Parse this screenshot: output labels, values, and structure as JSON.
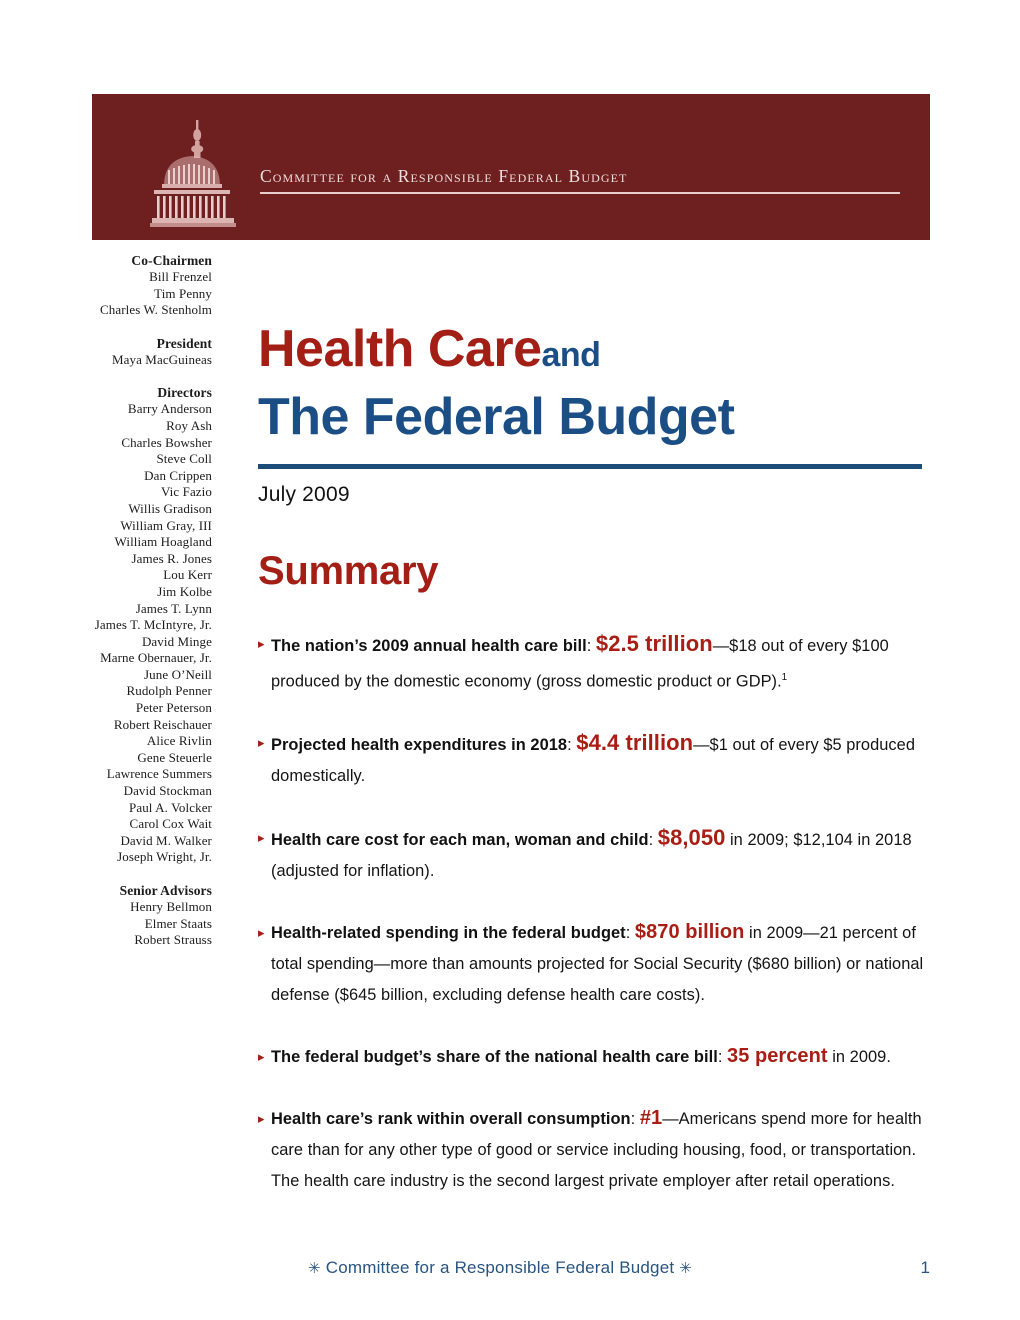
{
  "banner": {
    "logo_icon": "capitol-dome-icon",
    "organization": "Committee for a Responsible Federal Budget",
    "background_color": "#6E2020"
  },
  "sidebar": {
    "groups": [
      {
        "heading": "Co-Chairmen",
        "names": [
          "Bill Frenzel",
          "Tim Penny",
          "Charles W. Stenholm"
        ]
      },
      {
        "heading": "President",
        "names": [
          "Maya MacGuineas"
        ]
      },
      {
        "heading": "Directors",
        "names": [
          "Barry Anderson",
          "Roy Ash",
          "Charles Bowsher",
          "Steve Coll",
          "Dan Crippen",
          "Vic Fazio",
          "Willis Gradison",
          "William Gray, III",
          "William Hoagland",
          "James R. Jones",
          "Lou Kerr",
          "Jim Kolbe",
          "James T. Lynn",
          "James T. McIntyre, Jr.",
          "David Minge",
          "Marne Obernauer, Jr.",
          "June O’Neill",
          "Rudolph Penner",
          "Peter Peterson",
          "Robert Reischauer",
          "Alice Rivlin",
          "Gene Steuerle",
          "Lawrence Summers",
          "David Stockman",
          "Paul A. Volcker",
          "Carol Cox Wait",
          "David M. Walker",
          "Joseph Wright, Jr."
        ]
      },
      {
        "heading": "Senior Advisors",
        "names": [
          "Henry Bellmon",
          "Elmer Staats",
          "Robert Strauss"
        ]
      }
    ]
  },
  "title": {
    "line1_red": "Health Care",
    "line1_and": "and",
    "line2": "The Federal Budget",
    "date": "July 2009",
    "red_color": "#A31F16",
    "blue_color": "#1A4E85",
    "rule_color": "#1C4D78"
  },
  "summary": {
    "heading": "Summary",
    "bullets": [
      {
        "marker": "▸",
        "lead": "The nation’s 2009 annual health care bill",
        "colon": ": ",
        "stat": "$2.5 trillion",
        "rest": "—$18 out of every $100 produced by the domestic economy (gross domestic product or GDP).",
        "footnote": "1"
      },
      {
        "marker": "▸",
        "lead": "Projected health expenditures in 2018",
        "colon": ": ",
        "stat": "$4.4 trillion",
        "rest": "—$1 out of every $5 produced domestically.",
        "footnote": ""
      },
      {
        "marker": "▸",
        "lead": "Health care cost for each man, woman and child",
        "colon": ": ",
        "stat": "$8,050",
        "rest": " in 2009; $12,104 in 2018 (adjusted for inflation).",
        "footnote": ""
      },
      {
        "marker": "▸",
        "lead": "Health-related spending in the federal budget",
        "colon": ": ",
        "stat": "$870 billion",
        "rest": " in 2009—21 percent of total spending—more than amounts projected for Social Security ($680 billion) or national defense ($645 billion, excluding defense health care costs).",
        "footnote": ""
      },
      {
        "marker": "▸",
        "lead": "The federal budget’s share of the national health care bill",
        "colon": ": ",
        "stat": "35 percent",
        "rest": " in 2009.",
        "footnote": ""
      },
      {
        "marker": "▸",
        "lead": "Health care’s rank within overall consumption",
        "colon": ": ",
        "stat": "#1",
        "rest": "—Americans spend more for health care than for any other type of good or service including housing, food, or transportation. The health care industry is the second largest private employer after retail operations.",
        "footnote": ""
      }
    ]
  },
  "footer": {
    "asterisk_left": "✳",
    "text": "Committee for a Responsible Federal Budget",
    "asterisk_right": "✳",
    "page_number": "1",
    "color": "#28547F"
  }
}
